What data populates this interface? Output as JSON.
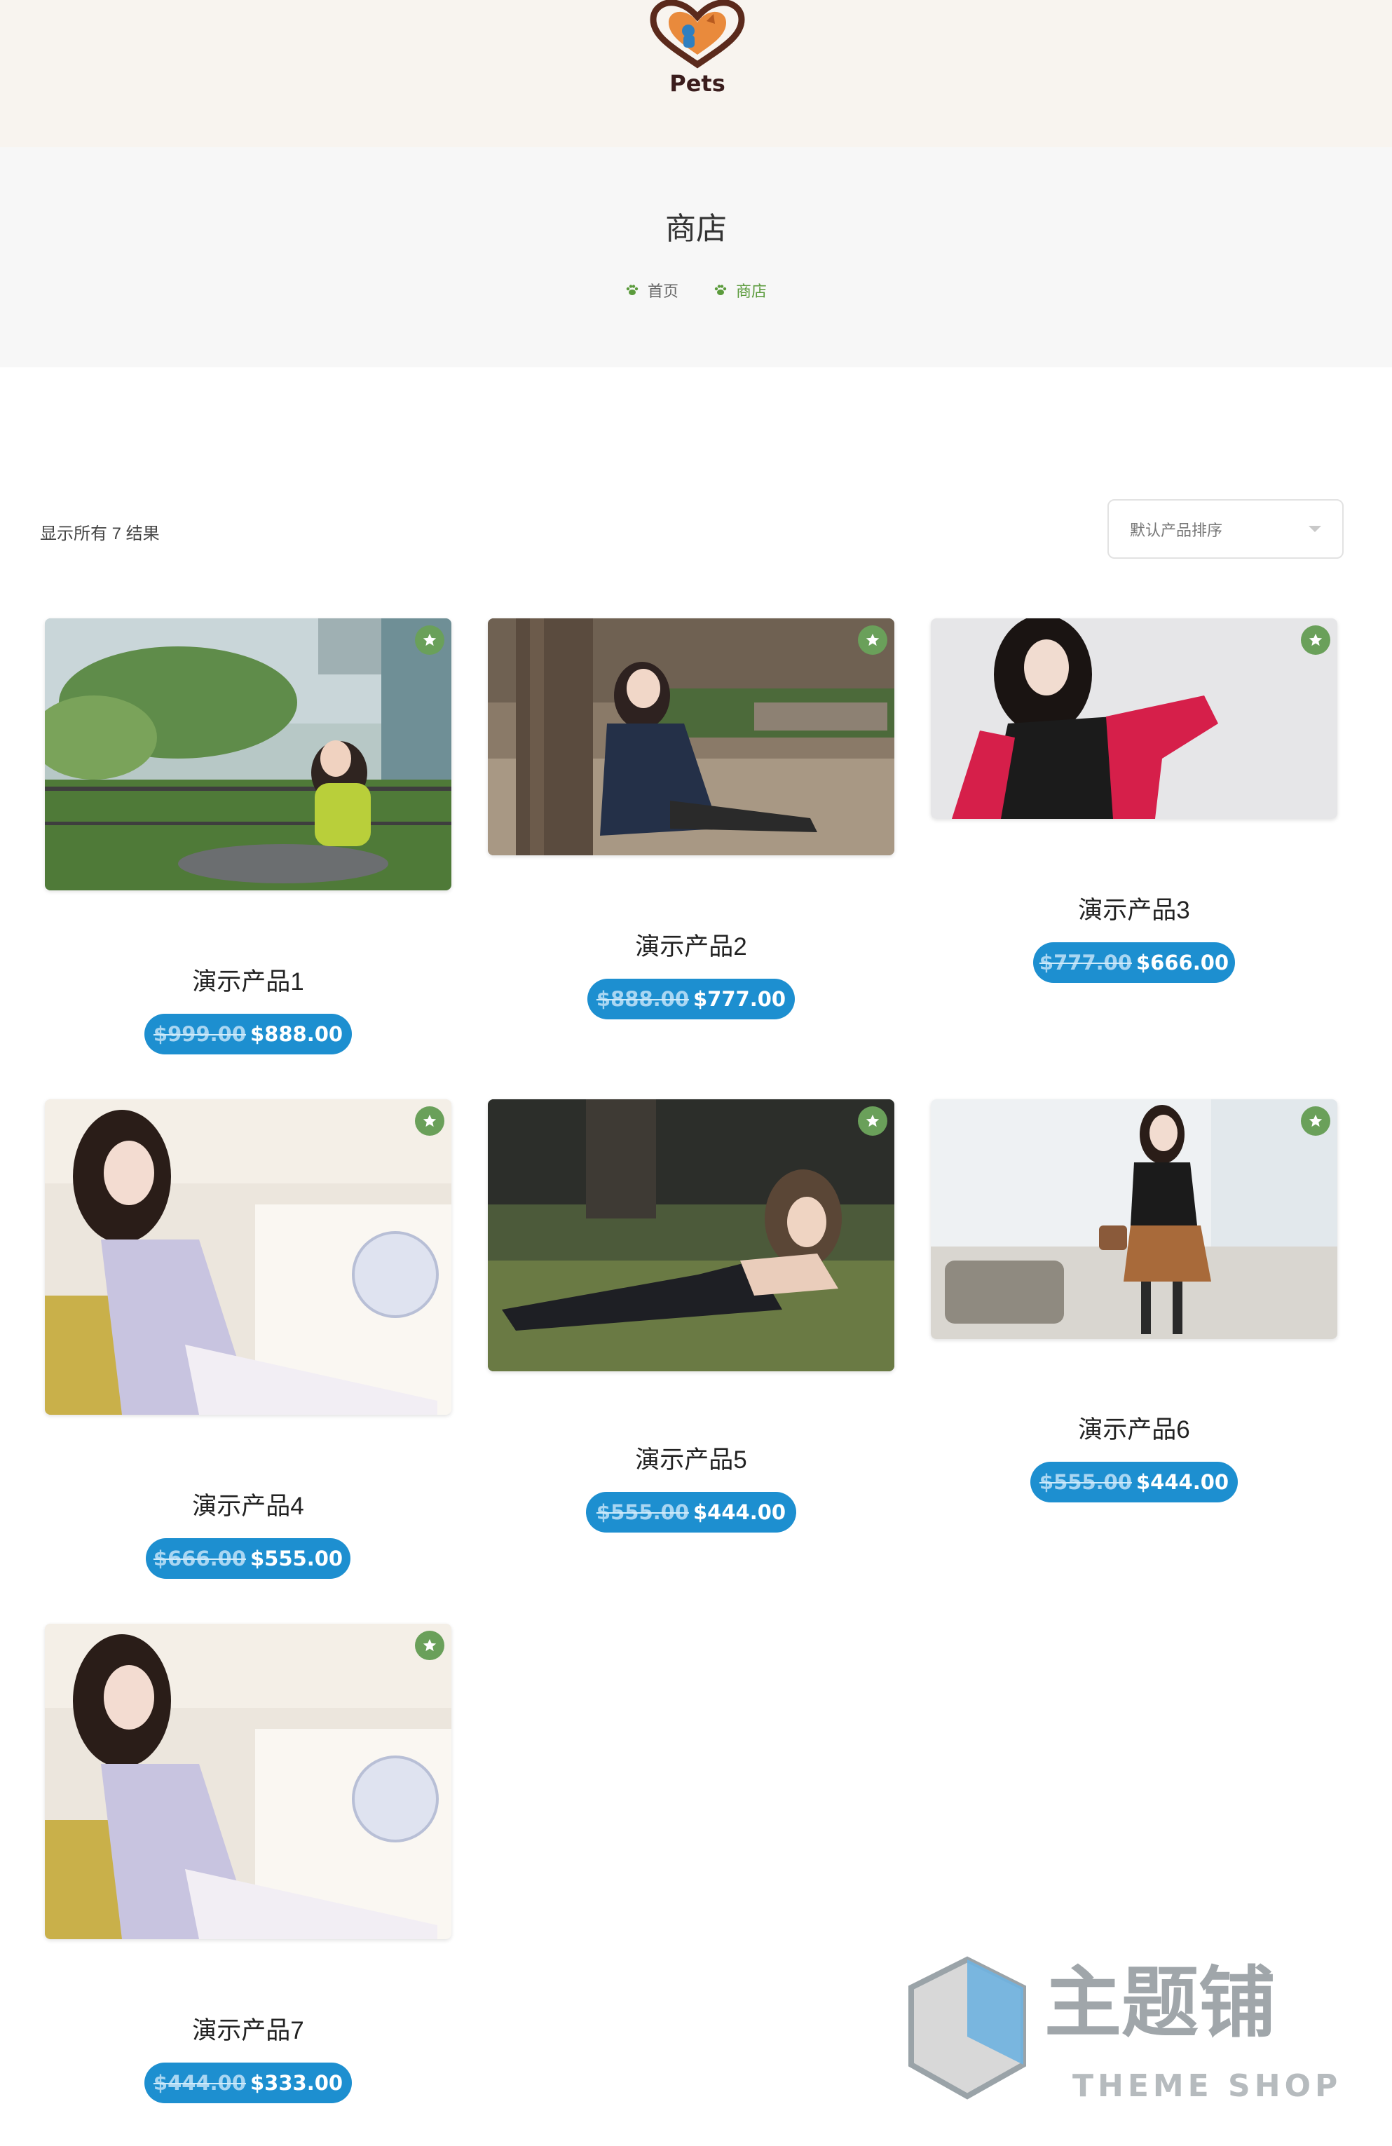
{
  "site": {
    "logo_text": "Pets"
  },
  "page": {
    "title": "商店",
    "breadcrumb": [
      {
        "label": "首页"
      },
      {
        "label": "商店"
      }
    ]
  },
  "shop": {
    "result_count": "显示所有 7 结果",
    "orderby_label": "默认产品排序"
  },
  "products": [
    {
      "name": "演示产品1",
      "old_price": "$999.00",
      "price": "$888.00"
    },
    {
      "name": "演示产品2",
      "old_price": "$888.00",
      "price": "$777.00"
    },
    {
      "name": "演示产品3",
      "old_price": "$777.00",
      "price": "$666.00"
    },
    {
      "name": "演示产品4",
      "old_price": "$666.00",
      "price": "$555.00"
    },
    {
      "name": "演示产品5",
      "old_price": "$555.00",
      "price": "$444.00"
    },
    {
      "name": "演示产品6",
      "old_price": "$555.00",
      "price": "$444.00"
    },
    {
      "name": "演示产品7",
      "old_price": "$444.00",
      "price": "$333.00"
    }
  ],
  "watermark": {
    "brand_cn": "主题铺",
    "brand_en": "THEME SHOP"
  },
  "colors": {
    "price_pill": "#1d8fd0",
    "badge": "#6aa05a",
    "breadcrumb_active": "#5b9b3c",
    "header_bg": "#f8f4ef"
  }
}
